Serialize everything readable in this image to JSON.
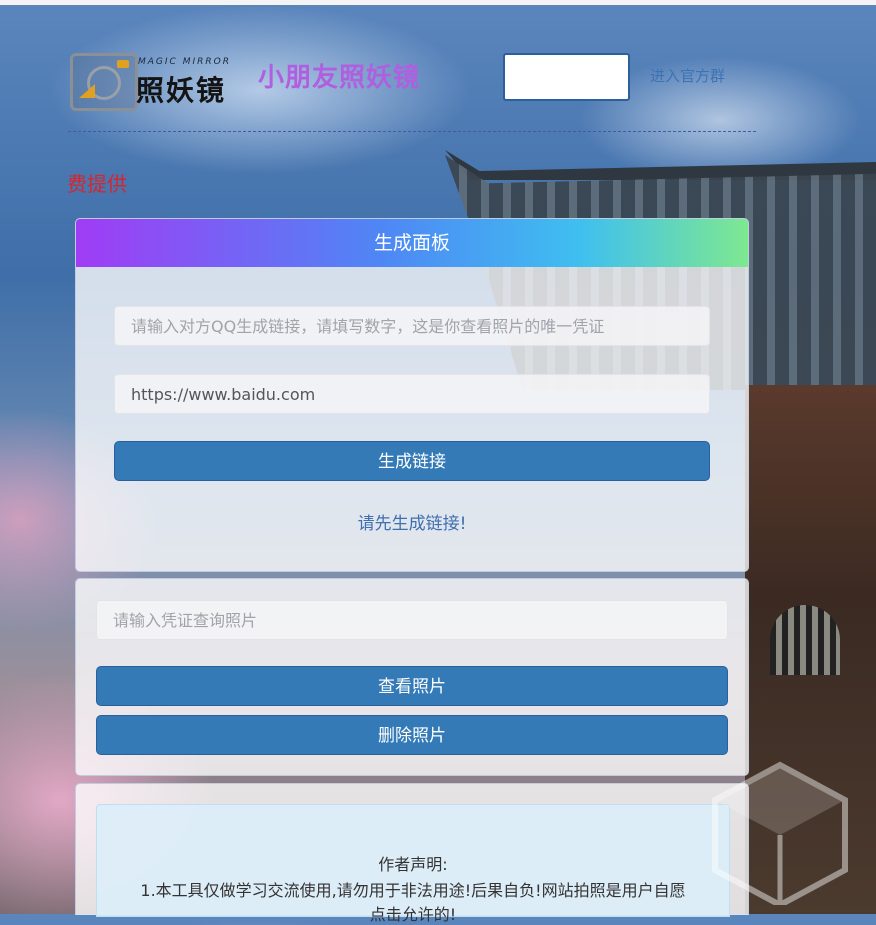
{
  "header": {
    "logo_sub": "MAGIC MIRROR",
    "logo_main": "照妖镜",
    "site_title": "小朋友照妖镜",
    "join_link": "进入官方群"
  },
  "notice_red": "费提供",
  "panel1": {
    "title": "生成面板",
    "qq_placeholder": "请输入对方QQ生成链接，请填写数字，这是你查看照片的唯一凭证",
    "url_value": "https://www.baidu.com",
    "generate_button": "生成链接",
    "tip": "请先生成链接!"
  },
  "panel2": {
    "credential_placeholder": "请输入凭证查询照片",
    "view_button": "查看照片",
    "delete_button": "删除照片"
  },
  "panel3": {
    "statement_title": "作者声明:",
    "statement_line1": "1.本工具仅做学习交流使用,请勿用于非法用途!后果自负!网站拍照是用户自愿",
    "statement_line2": "点击允许的!"
  },
  "colors": {
    "button_bg": "#337ab7",
    "title_purple": "#b05fe0",
    "red_text": "#d5262f",
    "gradient_start": "#a03cf5",
    "gradient_end": "#7ee890"
  }
}
